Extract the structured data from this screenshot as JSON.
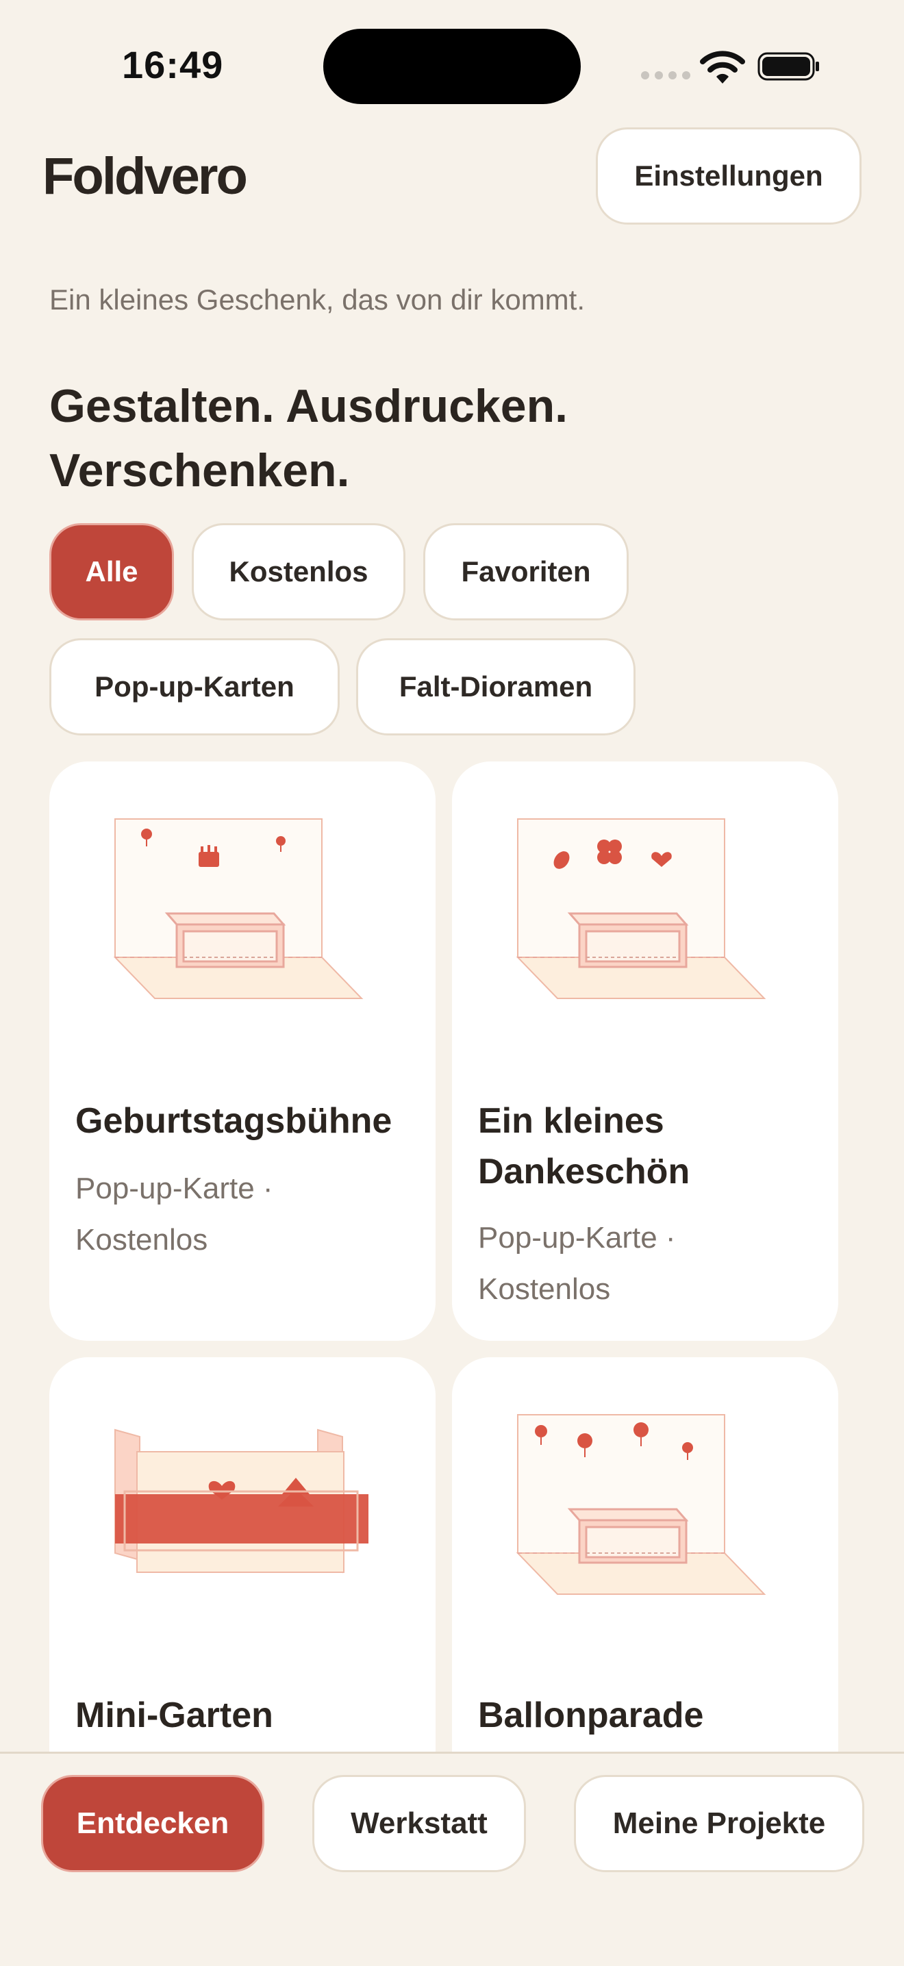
{
  "status_bar": {
    "time": "16:49"
  },
  "header": {
    "brand": "Foldvero",
    "settings_label": "Einstellungen"
  },
  "intro": {
    "subtitle": "Ein kleines Geschenk, das von dir kommt.",
    "headline_line1": "Gestalten. Ausdrucken.",
    "headline_line2": "Verschenken."
  },
  "filters": [
    {
      "label": "Alle",
      "active": true
    },
    {
      "label": "Kostenlos",
      "active": false
    },
    {
      "label": "Favoriten",
      "active": false
    },
    {
      "label": "Pop-up-Karten",
      "active": false
    },
    {
      "label": "Falt-Dioramen",
      "active": false
    }
  ],
  "cards": [
    {
      "title": "Geburtstagsbühne",
      "meta_line1": "Pop-up-Karte ·",
      "meta_line2": "Kostenlos"
    },
    {
      "title_line1": "Ein kleines",
      "title_line2": "Dankeschön",
      "meta_line1": "Pop-up-Karte ·",
      "meta_line2": "Kostenlos"
    },
    {
      "title": "Mini-Garten"
    },
    {
      "title": "Ballonparade"
    }
  ],
  "bottom_nav": [
    {
      "label": "Entdecken",
      "active": true
    },
    {
      "label": "Werkstatt",
      "active": false
    },
    {
      "label": "Meine Projekte",
      "active": false
    }
  ],
  "colors": {
    "background": "#f7f2ea",
    "accent": "#bf463a",
    "text": "#2b2520",
    "muted": "#7a716a",
    "illustration_fill": "#fdeedd",
    "illustration_red": "#d95443"
  }
}
